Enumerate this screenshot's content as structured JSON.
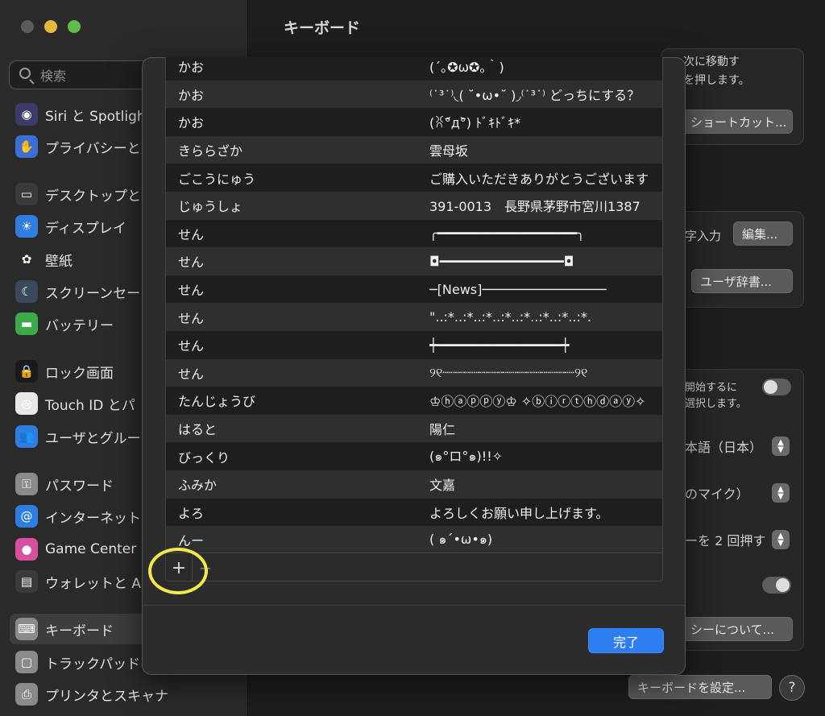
{
  "window": {
    "title": "キーボード"
  },
  "sidebar": {
    "search_placeholder": "検索",
    "items": [
      {
        "label": "Siri と Spotlight",
        "icon": "siri-icon",
        "color": "#3c3c6a",
        "glyph": "◉"
      },
      {
        "label": "プライバシーと",
        "icon": "privacy-hand-icon",
        "color": "#3a6fd8",
        "glyph": "✋"
      },
      {
        "label": "デスクトップと",
        "icon": "desktop-icon",
        "color": "#3a3a3a",
        "glyph": "▭"
      },
      {
        "label": "ディスプレイ",
        "icon": "display-icon",
        "color": "#2f7de1",
        "glyph": "☀"
      },
      {
        "label": "壁紙",
        "icon": "wallpaper-icon",
        "color": "#2a2a2a",
        "glyph": "✿"
      },
      {
        "label": "スクリーンセー",
        "icon": "screensaver-icon",
        "color": "#3a4a5a",
        "glyph": "☾"
      },
      {
        "label": "バッテリー",
        "icon": "battery-icon",
        "color": "#3daa4a",
        "glyph": "▬"
      },
      {
        "label": "ロック画面",
        "icon": "lock-screen-icon",
        "color": "#1a1a1a",
        "glyph": "🔒"
      },
      {
        "label": "Touch ID とパ",
        "icon": "touch-id-icon",
        "color": "#e8e8e8",
        "glyph": "◎"
      },
      {
        "label": "ユーザとグルー",
        "icon": "users-icon",
        "color": "#2f7de1",
        "glyph": "👥"
      },
      {
        "label": "パスワード",
        "icon": "key-icon",
        "color": "#8a8a8a",
        "glyph": "⚿"
      },
      {
        "label": "インターネット",
        "icon": "internet-accounts-icon",
        "color": "#2f7de1",
        "glyph": "@"
      },
      {
        "label": "Game Center",
        "icon": "game-center-icon",
        "color": "#d94fa0",
        "glyph": "●"
      },
      {
        "label": "ウォレットと A",
        "icon": "wallet-icon",
        "color": "#3a3a3a",
        "glyph": "▤"
      },
      {
        "label": "キーボード",
        "icon": "keyboard-icon",
        "color": "#8a8a8a",
        "glyph": "⌨"
      },
      {
        "label": "トラックパッド",
        "icon": "trackpad-icon",
        "color": "#8a8a8a",
        "glyph": "▢"
      },
      {
        "label": "プリンタとスキャナ",
        "icon": "printer-icon",
        "color": "#8a8a8a",
        "glyph": "⎙"
      }
    ]
  },
  "background": {
    "text_move_next": "次に移動す",
    "text_press": "を押します。",
    "btn_shortcut": "ショートカット...",
    "text_char_input": "字入力",
    "btn_edit": "編集...",
    "btn_user_dict": "ユーザ辞書...",
    "text_start": "開始するに",
    "text_select": "選択します。",
    "select_language": "本語（日本）",
    "select_mic": "のマイク）",
    "select_shortcut": "ーを 2 回押す",
    "btn_privacy": "シーについて...",
    "btn_keyboard_setup": "キーボードを設定...",
    "help_label": "?"
  },
  "dictionary": {
    "entries": [
      {
        "reading": "かお",
        "word": "(´｡✪ω✪｡｀)"
      },
      {
        "reading": "かお",
        "word": "⁽˙³˙⁾◟( ˘•ω•˘ )◞⁽˙³˙⁾ どっちにする？"
      },
      {
        "reading": "かお",
        "word": "(ꐦ°᷄д°᷅) ﾄﾞｷﾄﾞｷ*"
      },
      {
        "reading": "きららざか",
        "word": "雲母坂"
      },
      {
        "reading": "ごこうにゅう",
        "word": "ご購入いただきありがとうございます"
      },
      {
        "reading": "じゅうしょ",
        "word": "391-0013　長野県茅野市宮川1387"
      },
      {
        "reading": "せん",
        "word": "╭━━━━━━━━━━━━━━━━━━╮"
      },
      {
        "reading": "せん",
        "word": "◘━━━━━━━━━━━━━━━━◘"
      },
      {
        "reading": "せん",
        "word": "─[News]────────────────"
      },
      {
        "reading": "せん",
        "word": "\"..:*..:*..:*..:*..:*..:*..:*..:*."
      },
      {
        "reading": "せん",
        "word": "┿━━━━━━━━━━━━━━━━┿"
      },
      {
        "reading": "せん",
        "word": "୨୧┈┈┈┈┈┈┈┈┈┈┈┈┈┈┈┈┈୨୧"
      },
      {
        "reading": "たんじょうび",
        "word": "♔ⓗⓐⓟⓟⓨ♔ ✧ⓑⓘⓡⓣⓗⓓⓐⓨ✧"
      },
      {
        "reading": "はると",
        "word": "陽仁"
      },
      {
        "reading": "びっくり",
        "word": "(๑°ロ°๑)!!✧"
      },
      {
        "reading": "ふみか",
        "word": "文嘉"
      },
      {
        "reading": "よろ",
        "word": "よろしくお願い申し上げます。"
      },
      {
        "reading": "んー",
        "word": "( ๑´•ω•๑)"
      }
    ],
    "add_label": "+",
    "remove_label": "−",
    "done_label": "完了"
  },
  "colors": {
    "accent": "#2f7ef1",
    "highlight": "#f3e94a"
  }
}
